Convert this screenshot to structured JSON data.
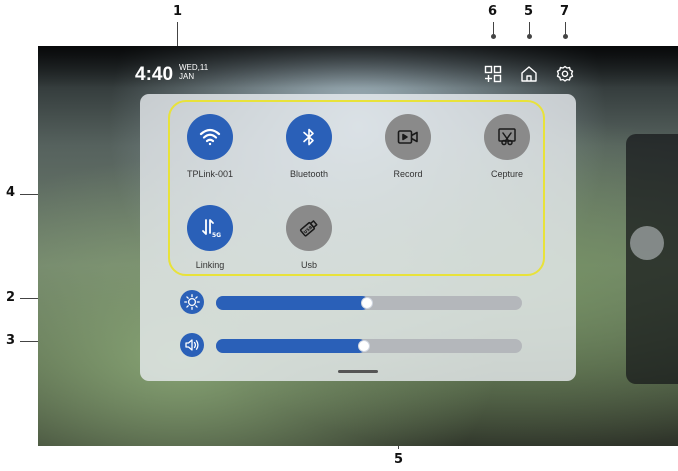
{
  "callouts": {
    "time": "1",
    "brightness": "2",
    "volume": "3",
    "tiles": "4",
    "home": "5",
    "background": "5",
    "multitask": "6",
    "settings": "7"
  },
  "status_bar": {
    "time": "4:40",
    "date_line1": "WED,11",
    "date_line2": "JAN"
  },
  "top_icons": [
    "multitask-icon",
    "home-icon",
    "settings-icon"
  ],
  "tiles": [
    {
      "label": "TPLink-001",
      "icon": "wifi-icon",
      "state": "on"
    },
    {
      "label": "Bluetooth",
      "icon": "bluetooth-icon",
      "state": "on"
    },
    {
      "label": "Record",
      "icon": "record-icon",
      "state": "off"
    },
    {
      "label": "Cepture",
      "icon": "capture-icon",
      "state": "off"
    },
    {
      "label": "Linking",
      "icon": "linking-5g-icon",
      "state": "on",
      "badge": "5G"
    },
    {
      "label": "Usb",
      "icon": "usb-icon",
      "state": "off",
      "badge": "USB"
    }
  ],
  "sliders": {
    "brightness": {
      "icon": "brightness-icon",
      "value": 0.5
    },
    "volume": {
      "icon": "volume-icon",
      "value": 0.49
    }
  },
  "colors": {
    "accent": "#2a60b8",
    "tile_off": "#8a8a8a",
    "highlight_box": "#e8e23a"
  }
}
